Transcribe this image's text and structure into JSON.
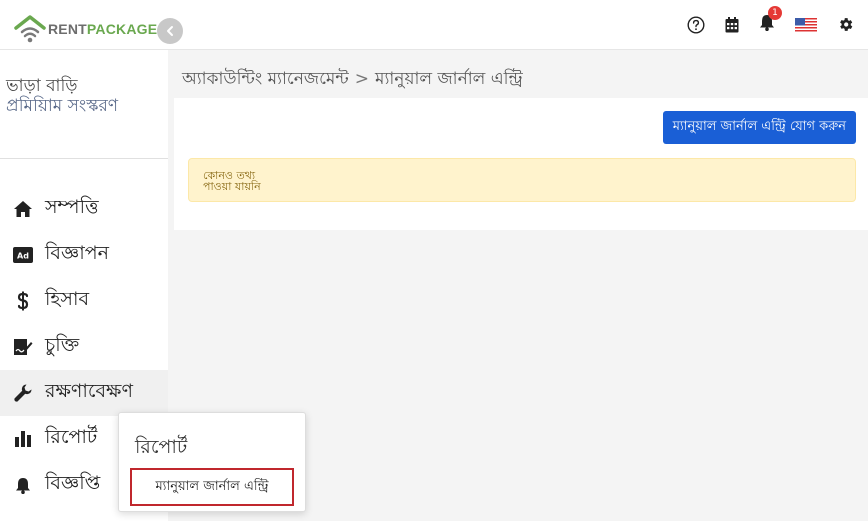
{
  "app": {
    "logo_rent": "RENT",
    "logo_package": "PACKAGE"
  },
  "topbar": {
    "notification_count": "1",
    "icons": [
      "help-icon",
      "calendar-icon",
      "bell-icon",
      "us-flag-icon",
      "gear-icon"
    ]
  },
  "sidebar": {
    "title": "ভাড়া বাড়ি",
    "subtitle": "প্রমিয়িাম সংস্করণ",
    "items": [
      {
        "label": "সম্পত্তি",
        "icon": "home-icon"
      },
      {
        "label": "বিজ্ঞাপন",
        "icon": "ad-icon"
      },
      {
        "label": "হিসাব",
        "icon": "dollar-icon"
      },
      {
        "label": "চুক্তি",
        "icon": "contract-icon"
      },
      {
        "label": "রক্ষণাবেক্ষণ",
        "icon": "wrench-icon"
      },
      {
        "label": "রিপোর্ট",
        "icon": "bar-chart-icon"
      },
      {
        "label": "বিজ্ঞপ্তি",
        "icon": "bell-icon"
      }
    ]
  },
  "breadcrumb": {
    "parent": "অ্যাকাউন্টিং ম্যানেজমেন্ট",
    "separator": ">",
    "current": "ম্যানুয়াল জার্নাল এন্ট্রি"
  },
  "main": {
    "add_button_label": "ম্যানুয়াল জার্নাল এন্ট্রি যোগ করুন",
    "alert_line1": "কোনও তথ্য",
    "alert_line2": "পাওয়া যায়নি"
  },
  "popover": {
    "title": "রিপোর্ট",
    "link_label": "ম্যানুয়াল জার্নাল এন্ট্রি"
  },
  "colors": {
    "accent": "#1a5fd6",
    "brand_green": "#6aa84f",
    "alert_bg": "#fff3cd",
    "highlight_border": "#c0272d"
  }
}
